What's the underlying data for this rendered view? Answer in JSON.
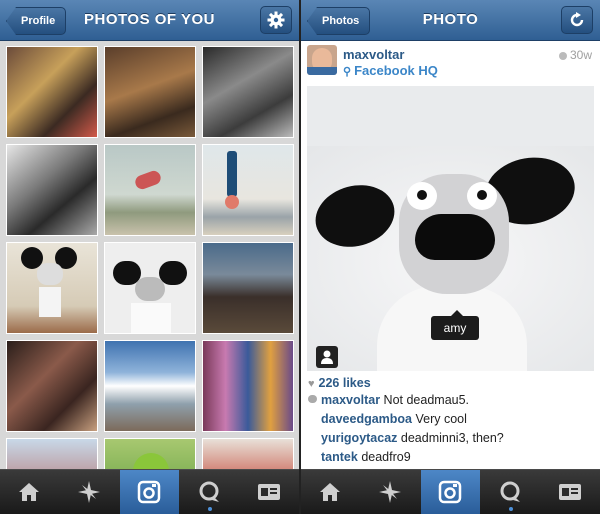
{
  "left": {
    "nav": {
      "back_label": "Profile",
      "title": "PHOTOS OF YOU",
      "settings_icon": "gear-icon"
    },
    "tabs": [
      {
        "icon": "home-icon"
      },
      {
        "icon": "explore-star-icon"
      },
      {
        "icon": "camera-icon",
        "active": true
      },
      {
        "icon": "news-bubble-icon"
      },
      {
        "icon": "profile-card-icon"
      }
    ]
  },
  "right": {
    "nav": {
      "back_label": "Photos",
      "title": "PHOTO",
      "refresh_icon": "refresh-icon"
    },
    "post": {
      "username": "maxvoltar",
      "location": "Facebook HQ",
      "time": "30w",
      "tag_name": "amy",
      "likes": "226 likes",
      "comments": [
        {
          "user": "maxvoltar",
          "text": "Not deadmau5."
        },
        {
          "user": "daveedgamboa",
          "text": "Very cool"
        },
        {
          "user": "yurigoytacaz",
          "text": "deadminni3, then?"
        },
        {
          "user": "tantek",
          "text": "deadfro9"
        },
        {
          "user": "",
          "text": ""
        }
      ]
    },
    "tabs": [
      {
        "icon": "home-icon"
      },
      {
        "icon": "explore-star-icon"
      },
      {
        "icon": "camera-icon",
        "active": true
      },
      {
        "icon": "news-bubble-icon"
      },
      {
        "icon": "profile-card-icon"
      }
    ]
  },
  "colors": {
    "nav_blue": "#3c6b9e",
    "link_blue": "#2c5a87",
    "location_blue": "#3b86c8",
    "tab_active": "#3a74b5"
  }
}
